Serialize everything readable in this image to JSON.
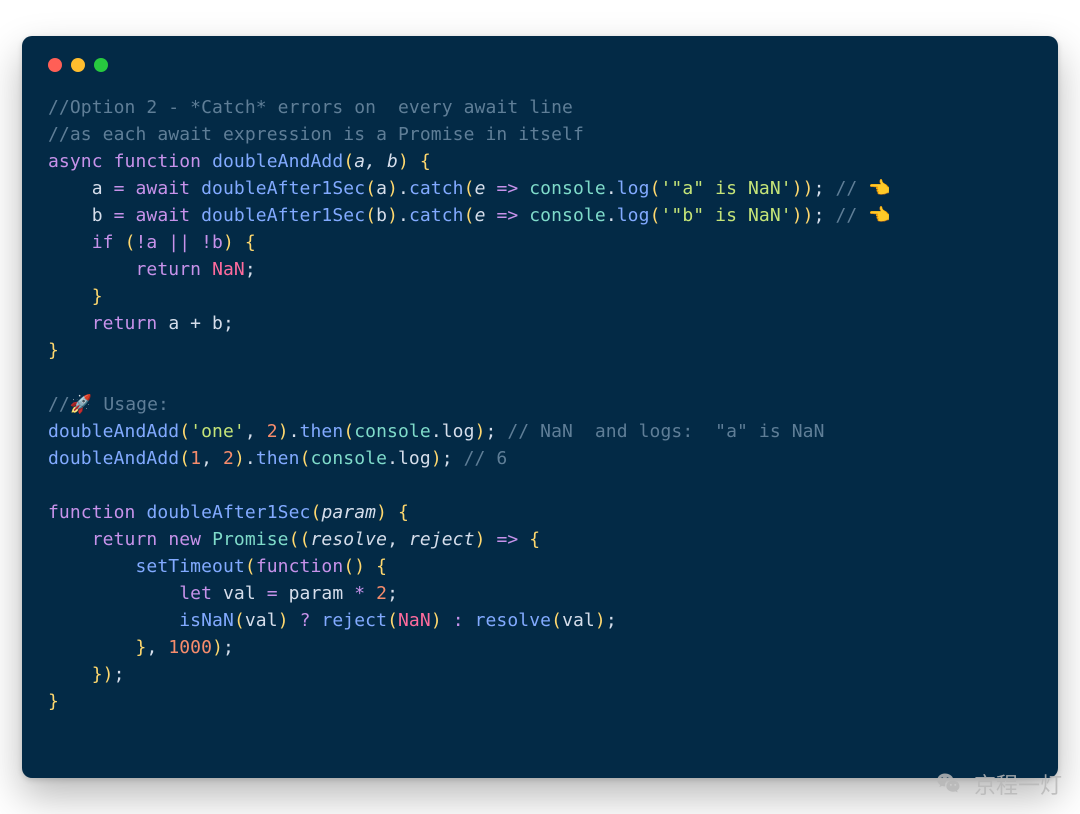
{
  "code": {
    "l1_a": "//Option 2 - *Catch* errors on  every await line",
    "l2_a": "//as each await expression is a Promise in itself",
    "l3_async": "async",
    "l3_function": "function",
    "l3_fnname": "doubleAndAdd",
    "l3_params": "a, b",
    "l4_await": "await",
    "l4_a": "a",
    "l4_call": "doubleAfter1Sec",
    "l4_arg": "a",
    "l4_catch": "catch",
    "l4_e": "e",
    "l4_arrow": "=>",
    "l4_console": "console",
    "l4_log": "log",
    "l4_str": "'\"a\" is NaN'",
    "l4_trail": "// 👈",
    "l5_b": "b",
    "l5_arg": "b",
    "l5_str": "'\"b\" is NaN'",
    "l5_trail": "// 👈",
    "l6_if": "if",
    "l6_cond": "!a || !b",
    "l7_return": "return",
    "l7_nan": "NaN",
    "l9_return": "return",
    "l9_expr": "a + b",
    "l12": "//🚀 Usage:",
    "l13_fn": "doubleAndAdd",
    "l13_s": "'one'",
    "l13_n": "2",
    "l13_then": "then",
    "l13_console": "console",
    "l13_log": "log",
    "l13_c": "// NaN  and logs:  \"a\" is NaN",
    "l14_a": "1",
    "l14_b": "2",
    "l14_c": "// 6",
    "l16_function": "function",
    "l16_fn": "doubleAfter1Sec",
    "l16_p": "param",
    "l17_return": "return",
    "l17_new": "new",
    "l17_prom": "Promise",
    "l17_res": "resolve",
    "l17_rej": "reject",
    "l17_arrow": "=>",
    "l18_set": "setTimeout",
    "l18_fn": "function",
    "l19_let": "let",
    "l19_val": "val",
    "l19_param": "param",
    "l19_two": "2",
    "l20_isnan": "isNaN",
    "l20_val": "val",
    "l20_rej": "reject",
    "l20_nan": "NaN",
    "l20_res": "resolve",
    "l20_val2": "val",
    "l21_num": "1000"
  },
  "watermark": "京程一灯"
}
